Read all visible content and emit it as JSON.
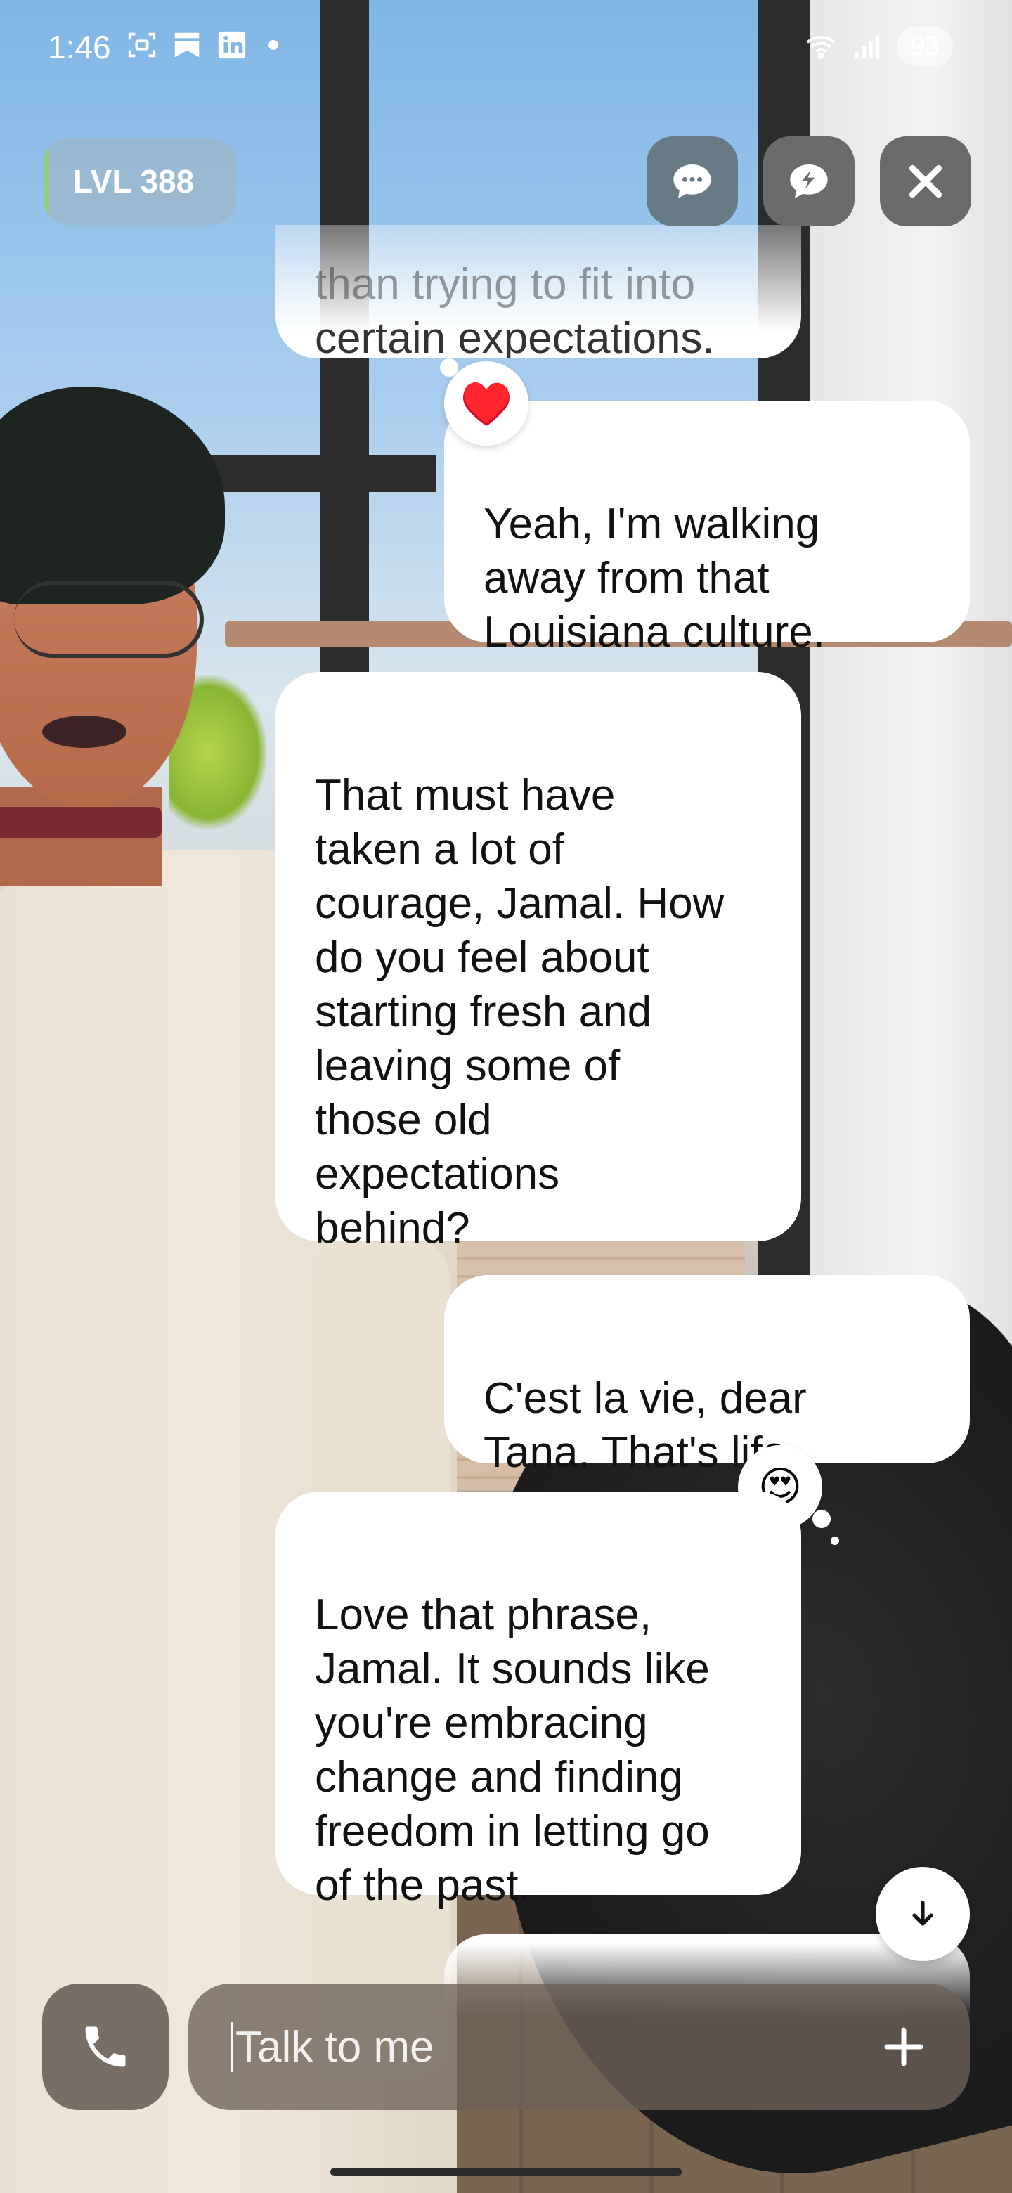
{
  "status_bar": {
    "time": "1:46",
    "battery": "93",
    "icons": [
      "screenshot-icon",
      "bookmark-icon",
      "linkedin-icon",
      "dot-icon",
      "wifi-icon",
      "signal-icon"
    ]
  },
  "header": {
    "level_label": "LVL 388",
    "level_progress": 0.03
  },
  "chat": {
    "messages": [
      {
        "role": "ai",
        "text_line1": "than trying to fit into",
        "text_line2": "certain expectations.",
        "faded": true
      },
      {
        "role": "user",
        "text": "Yeah, I'm walking\naway from that\nLouisiana culture.",
        "reaction": "♥️"
      },
      {
        "role": "ai",
        "text": "That must have\ntaken a lot of\ncourage, Jamal. How\ndo you feel about\nstarting fresh and\nleaving some of\nthose old\nexpectations\nbehind?"
      },
      {
        "role": "user",
        "text": "C'est la vie, dear\nTana. That's life.",
        "reaction": "😍"
      },
      {
        "role": "ai",
        "text": "Love that phrase,\nJamal. It sounds like\nyou're embracing\nchange and finding\nfreedom in letting go\nof the past."
      }
    ]
  },
  "input": {
    "placeholder": "Talk to me"
  },
  "colors": {
    "bubble": "#ffffff",
    "level_accent": "#8fd07a",
    "chat_button": "#677a86"
  }
}
